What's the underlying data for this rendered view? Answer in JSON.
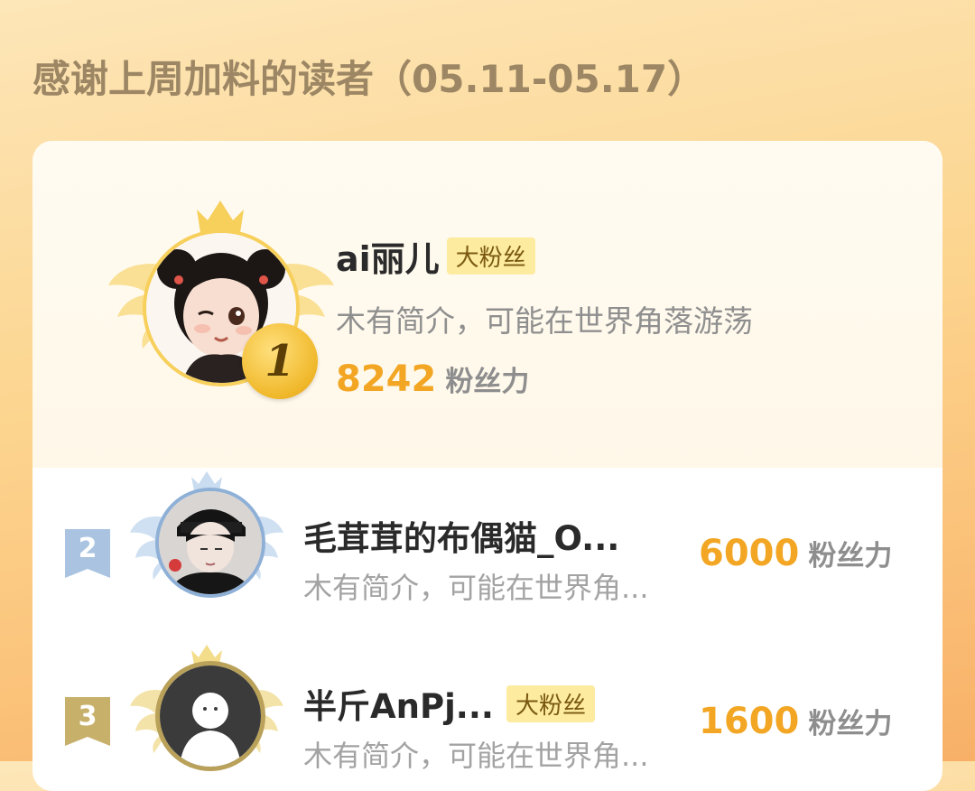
{
  "title": "感谢上周加料的读者（05.11-05.17）",
  "colors": {
    "accent": "#f2a623",
    "badge_bg": "#fdeb9f",
    "gold": "#f7cf5b",
    "silver": "#9db8d6",
    "bronze": "#b9a15a"
  },
  "readers": [
    {
      "rank": "1",
      "name": "ai丽儿",
      "badge": "大粉丝",
      "bio": "木有简介，可能在世界角落游荡",
      "score": "8242",
      "unit": "粉丝力",
      "avatar": "avatar-girl-icon"
    },
    {
      "rank": "2",
      "name": "毛茸茸的布偶猫_O...",
      "badge": "",
      "bio": "木有简介，可能在世界角...",
      "score": "6000",
      "unit": "粉丝力",
      "avatar": "avatar-boy-icon"
    },
    {
      "rank": "3",
      "name": "半斤AnPj...",
      "badge": "大粉丝",
      "bio": "木有简介，可能在世界角...",
      "score": "1600",
      "unit": "粉丝力",
      "avatar": "avatar-default-icon"
    }
  ]
}
